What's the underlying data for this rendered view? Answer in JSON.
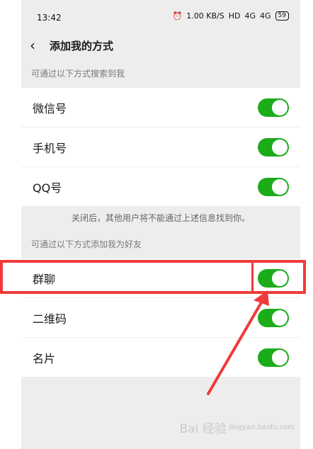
{
  "status_bar": {
    "time": "13:42",
    "indicators": [
      "⏰",
      "1.00 KB/S",
      "HD",
      "4G",
      "4G"
    ],
    "battery": "59"
  },
  "nav": {
    "title": "添加我的方式"
  },
  "search_section": {
    "header": "可通过以下方式搜索到我",
    "items": [
      {
        "label": "微信号",
        "enabled": true
      },
      {
        "label": "手机号",
        "enabled": true
      },
      {
        "label": "QQ号",
        "enabled": true
      }
    ],
    "notice": "关闭后，其他用户将不能通过上述信息找到你。"
  },
  "add_section": {
    "header": "可通过以下方式添加我为好友",
    "items": [
      {
        "label": "群聊",
        "enabled": true
      },
      {
        "label": "二维码",
        "enabled": true
      },
      {
        "label": "名片",
        "enabled": true
      }
    ]
  },
  "colors": {
    "toggle_on": "#1aad19",
    "annotation": "#f03a3a"
  },
  "watermark": {
    "text": "Bai 经验",
    "sub": "jingyan.baidu.com"
  }
}
